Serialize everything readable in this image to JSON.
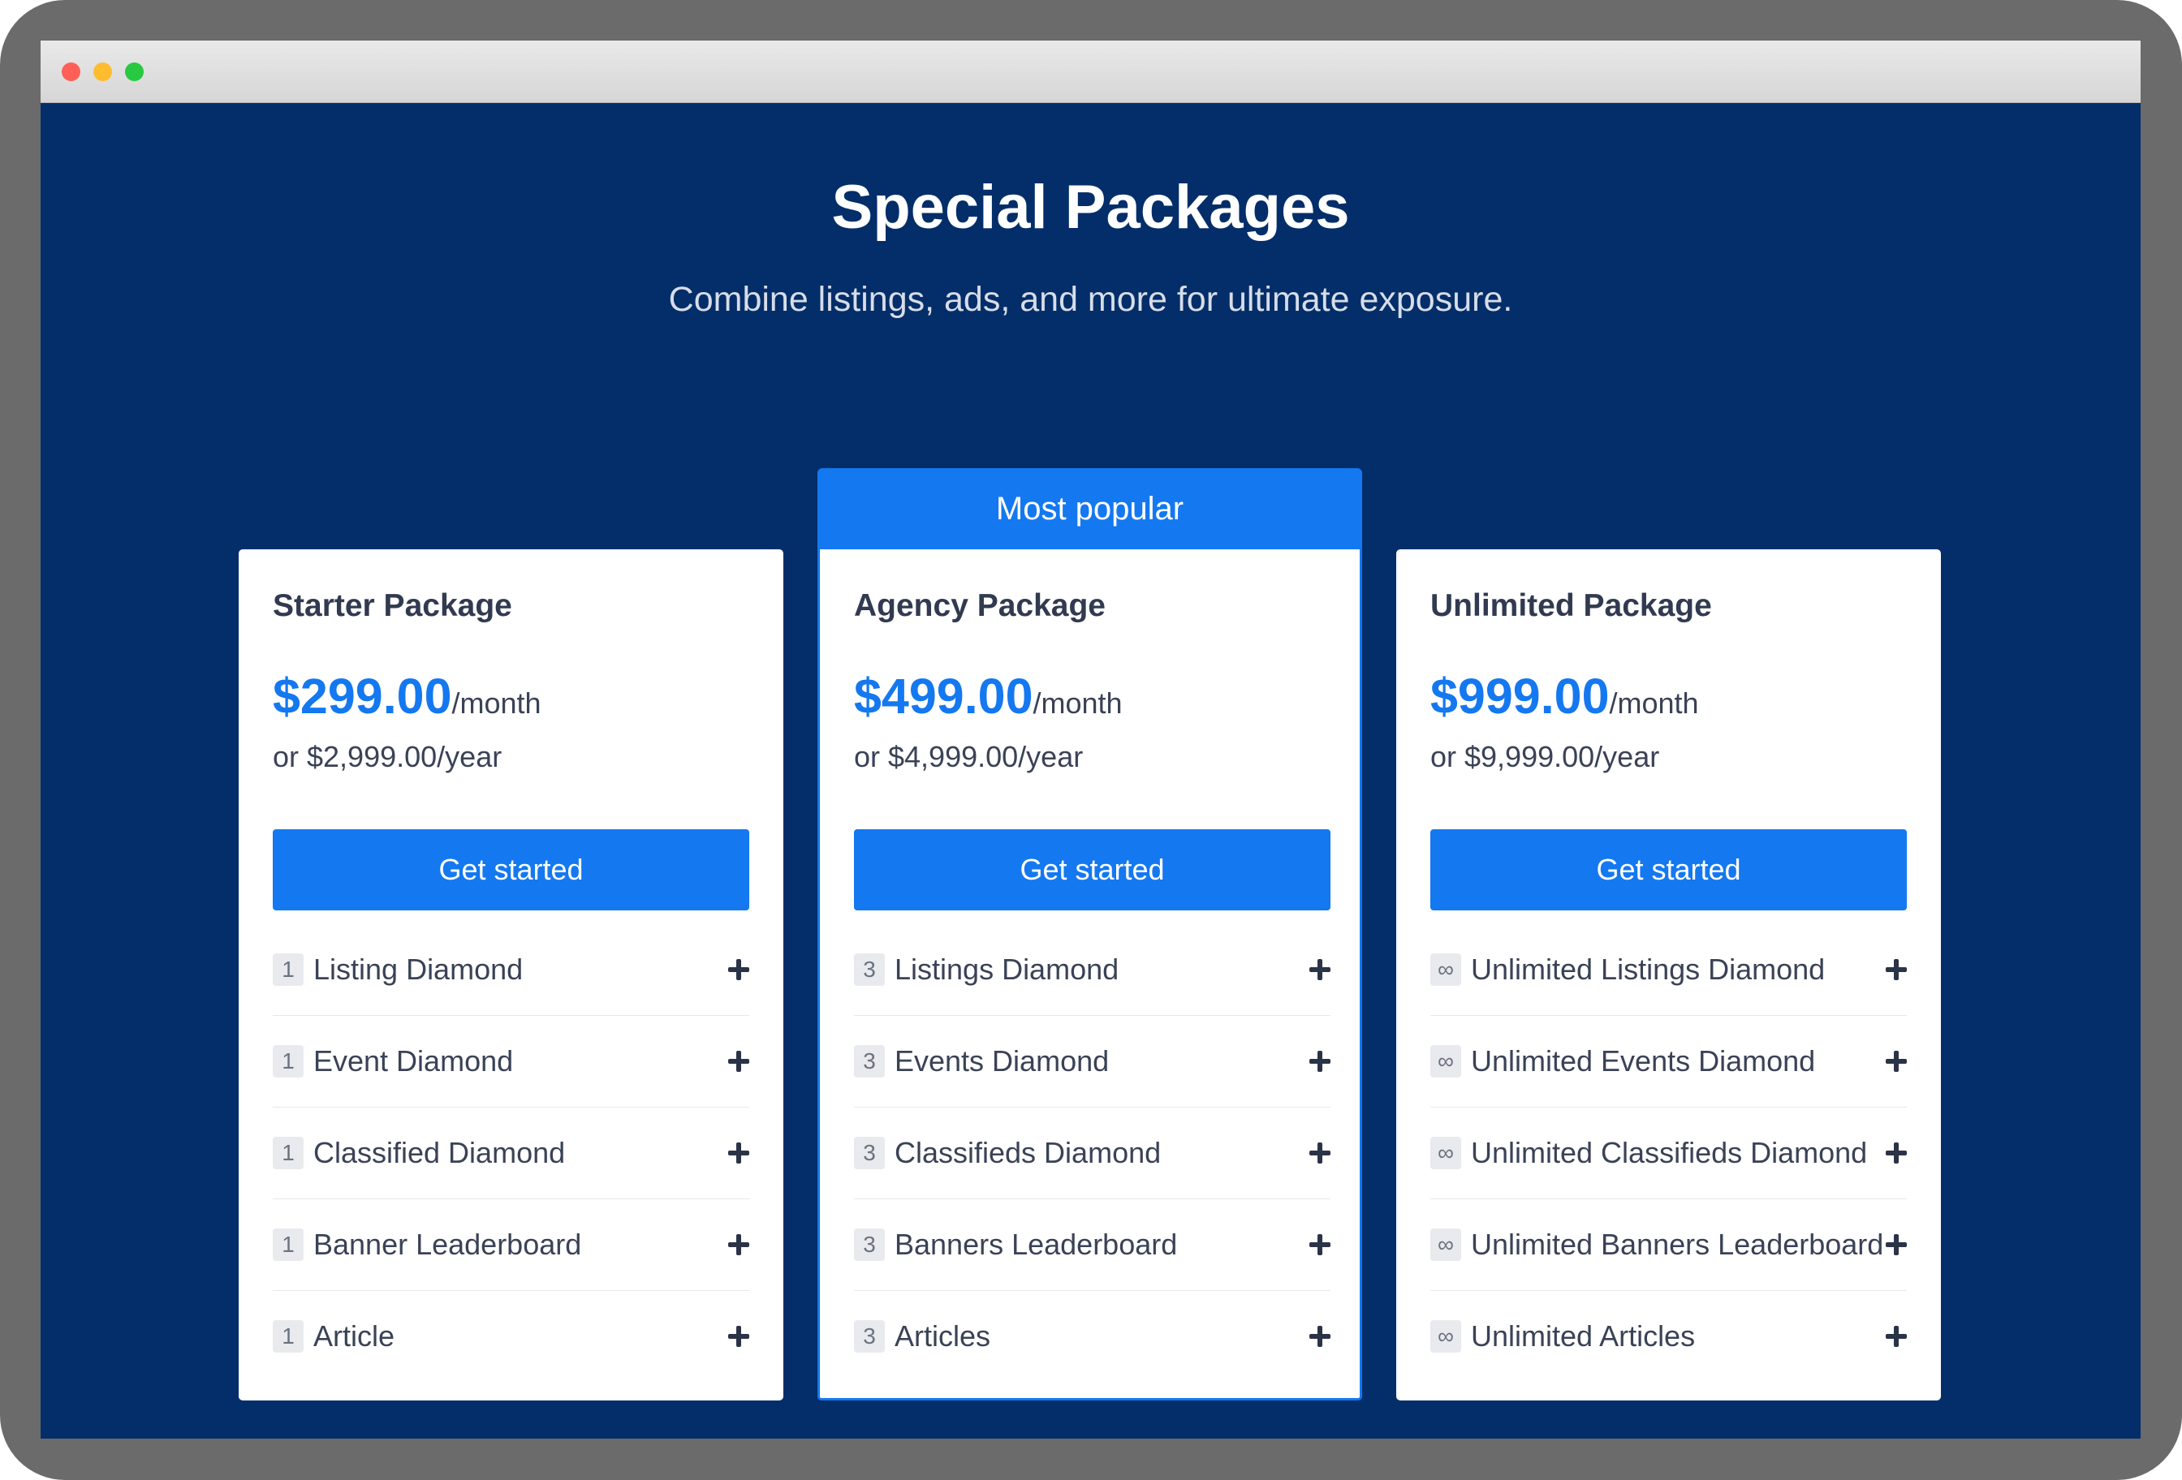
{
  "header": {
    "title": "Special Packages",
    "subtitle": "Combine listings, ads, and more for ultimate exposure."
  },
  "popular_label": "Most popular",
  "packages": [
    {
      "name": "Starter Package",
      "price": "$299.00",
      "period": "/month",
      "yearly": "or $2,999.00/year",
      "cta": "Get started",
      "features": [
        {
          "qty": "1",
          "label": "Listing Diamond"
        },
        {
          "qty": "1",
          "label": "Event Diamond"
        },
        {
          "qty": "1",
          "label": "Classified Diamond"
        },
        {
          "qty": "1",
          "label": "Banner Leaderboard"
        },
        {
          "qty": "1",
          "label": "Article"
        }
      ]
    },
    {
      "name": "Agency Package",
      "price": "$499.00",
      "period": "/month",
      "yearly": "or $4,999.00/year",
      "cta": "Get started",
      "features": [
        {
          "qty": "3",
          "label": "Listings Diamond"
        },
        {
          "qty": "3",
          "label": "Events Diamond"
        },
        {
          "qty": "3",
          "label": "Classifieds Diamond"
        },
        {
          "qty": "3",
          "label": "Banners Leaderboard"
        },
        {
          "qty": "3",
          "label": "Articles"
        }
      ]
    },
    {
      "name": "Unlimited Package",
      "price": "$999.00",
      "period": "/month",
      "yearly": "or $9,999.00/year",
      "cta": "Get started",
      "features": [
        {
          "qty": "∞",
          "label": "Unlimited Listings Diamond"
        },
        {
          "qty": "∞",
          "label": "Unlimited Events Diamond"
        },
        {
          "qty": "∞",
          "label": "Unlimited Classifieds Diamond"
        },
        {
          "qty": "∞",
          "label": "Unlimited Banners Leaderboard"
        },
        {
          "qty": "∞",
          "label": "Unlimited Articles"
        }
      ]
    }
  ],
  "colors": {
    "background": "#032e69",
    "accent": "#1478f0",
    "card": "#ffffff",
    "text_dark": "#313a50"
  },
  "icons": {
    "expand": "plus-icon",
    "window_controls": [
      "close-dot",
      "minimize-dot",
      "zoom-dot"
    ]
  }
}
